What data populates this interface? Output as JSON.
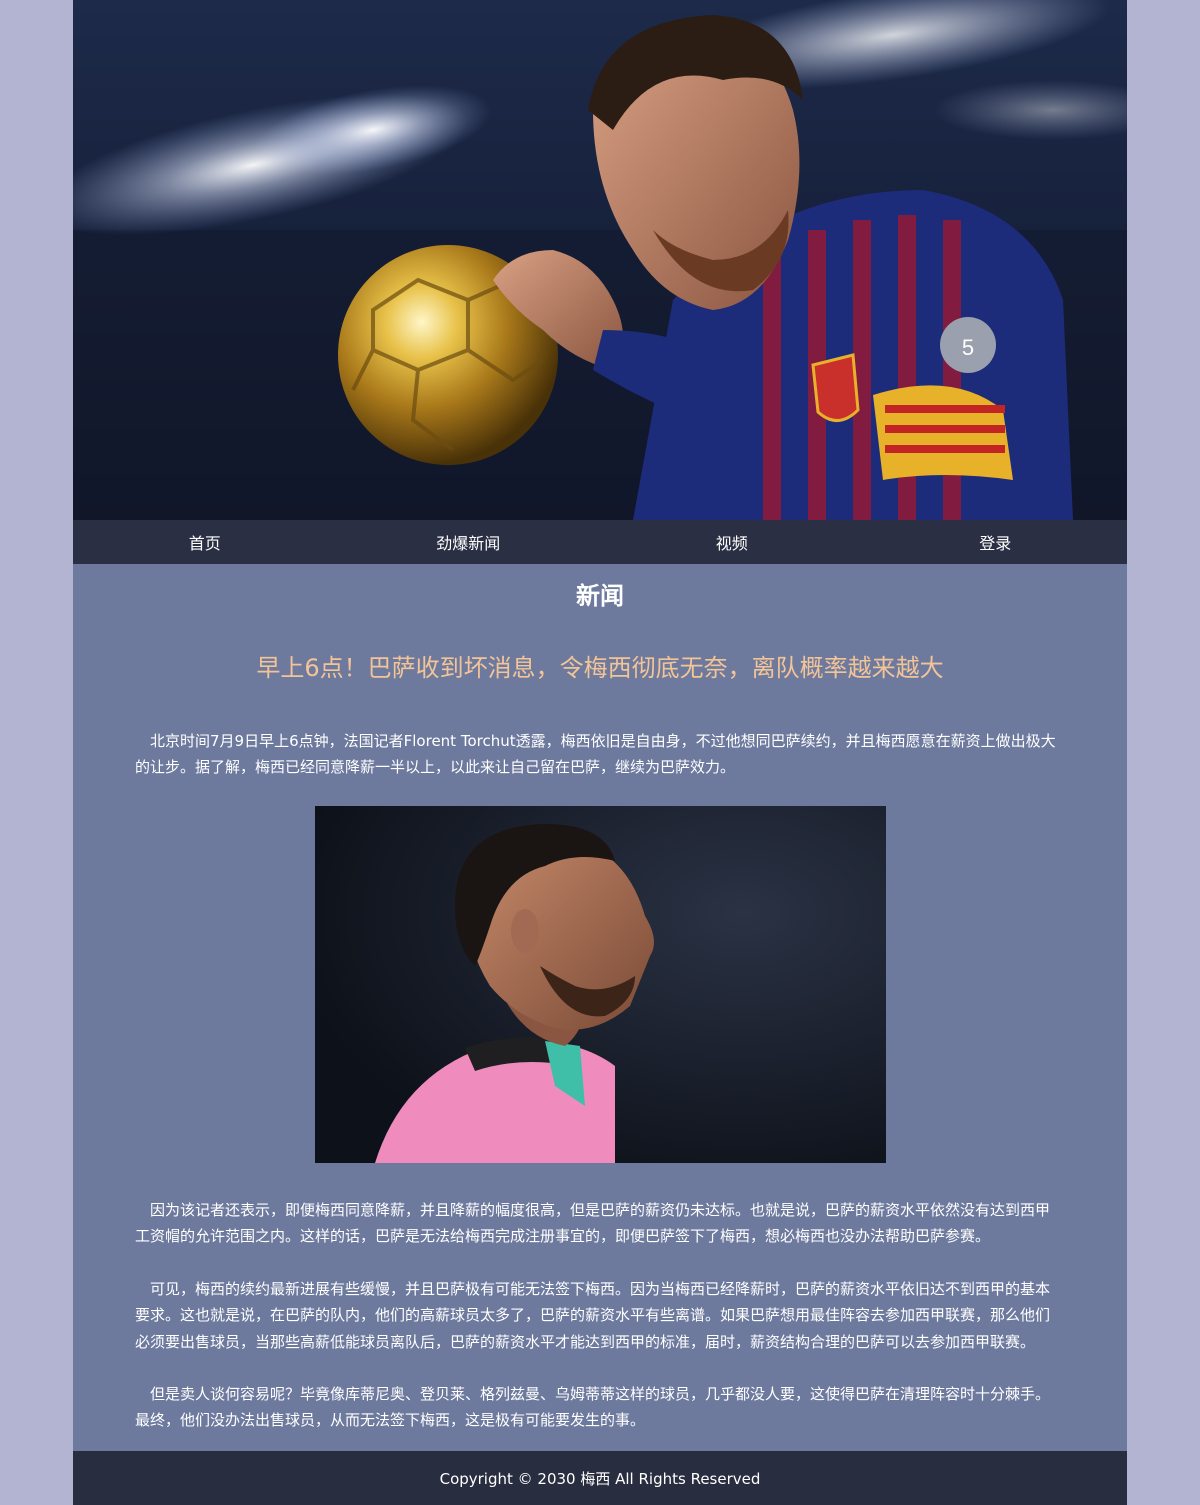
{
  "nav": {
    "items": [
      {
        "label": "首页"
      },
      {
        "label": "劲爆新闻"
      },
      {
        "label": "视频"
      },
      {
        "label": "登录"
      }
    ]
  },
  "main": {
    "section_title": "新闻",
    "headline": "早上6点！巴萨收到坏消息，令梅西彻底无奈，离队概率越来越大",
    "paragraphs": [
      "北京时间7月9日早上6点钟，法国记者Florent Torchut透露，梅西依旧是自由身，不过他想同巴萨续约，并且梅西愿意在薪资上做出极大的让步。据了解，梅西已经同意降薪一半以上，以此来让自己留在巴萨，继续为巴萨效力。",
      "因为该记者还表示，即便梅西同意降薪，并且降薪的幅度很高，但是巴萨的薪资仍未达标。也就是说，巴萨的薪资水平依然没有达到西甲工资帽的允许范围之内。这样的话，巴萨是无法给梅西完成注册事宜的，即便巴萨签下了梅西，想必梅西也没办法帮助巴萨参赛。",
      "可见，梅西的续约最新进展有些缓慢，并且巴萨极有可能无法签下梅西。因为当梅西已经降薪时，巴萨的薪资水平依旧达不到西甲的基本要求。这也就是说，在巴萨的队内，他们的高薪球员太多了，巴萨的薪资水平有些离谱。如果巴萨想用最佳阵容去参加西甲联赛，那么他们必须要出售球员，当那些高薪低能球员离队后，巴萨的薪资水平才能达到西甲的标准，届时，薪资结构合理的巴萨可以去参加西甲联赛。",
      "但是卖人谈何容易呢？毕竟像库蒂尼奥、登贝莱、格列兹曼、乌姆蒂蒂这样的球员，几乎都没人要，这使得巴萨在清理阵容时十分棘手。最终，他们没办法出售球员，从而无法签下梅西，这是极有可能要发生的事。"
    ]
  },
  "footer": {
    "copyright": "Copyright © 2030 梅西 All Rights Reserved"
  },
  "colors": {
    "page_bg": "#b2b4d2",
    "content_bg": "#6d7a9e",
    "nav_bg": "#2a2f43",
    "footer_bg": "#292d40",
    "headline": "#f2c497"
  }
}
